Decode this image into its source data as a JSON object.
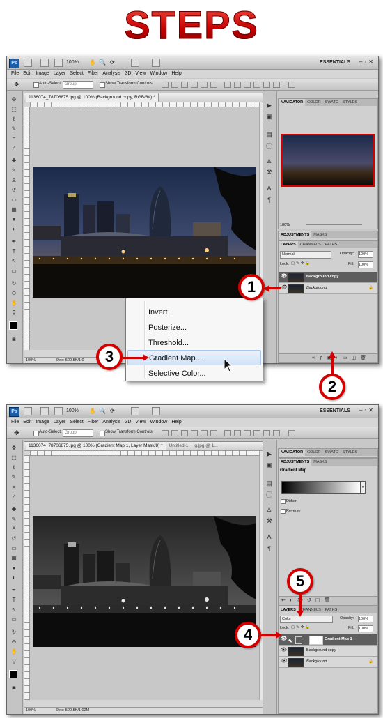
{
  "title": "STEPS",
  "app": {
    "logo": "Ps",
    "zoom": "100%",
    "workspace": "ESSENTIALS",
    "menu": [
      "File",
      "Edit",
      "Image",
      "Layer",
      "Select",
      "Filter",
      "Analysis",
      "3D",
      "View",
      "Window",
      "Help"
    ],
    "options": {
      "auto_select_label": "Auto-Select:",
      "auto_select_value": "Group",
      "transform_label": "Show Transform Controls"
    }
  },
  "window1": {
    "doc_tab": "1136074_78706875.jpg @ 100% (Background copy, RGB/8#) *",
    "status_zoom": "100%",
    "status_doc": "Doc: 520.5K/1.0",
    "navigator_tabs": [
      "NAVIGATOR",
      "COLOR",
      "SWATC",
      "STYLES"
    ],
    "navigator_zoom": "100%",
    "adj_tabs": [
      "ADJUSTMENTS",
      "MASKS"
    ],
    "layers_tabs": [
      "LAYERS",
      "CHANNELS",
      "PATHS"
    ],
    "blend_mode": "Normal",
    "opacity_label": "Opacity:",
    "opacity_value": "100%",
    "lock_label": "Lock:",
    "fill_label": "Fill:",
    "fill_value": "100%",
    "layers": [
      "Background copy",
      "Background"
    ]
  },
  "context_menu": {
    "items": [
      "Invert",
      "Posterize...",
      "Threshold...",
      "Gradient Map...",
      "Selective Color..."
    ],
    "highlighted_index": 3
  },
  "window2": {
    "doc_tabs": [
      "1136074_78706875.jpg @ 100% (Gradient Map 1, Layer Mask/8) *",
      "Untitled-1",
      "g.jpg @ 1..."
    ],
    "status_zoom": "100%",
    "status_doc": "Doc: 520.5K/1.02M",
    "navigator_tabs": [
      "NAVIGATOR",
      "COLOR",
      "SWATC",
      "STYLES"
    ],
    "adj_tabs": [
      "ADJUSTMENTS",
      "MASKS"
    ],
    "adj_title": "Gradient Map",
    "dither_label": "Dither",
    "reverse_label": "Reverse",
    "layers_tabs": [
      "LAYERS",
      "CHANNELS",
      "PATHS"
    ],
    "blend_mode": "Color",
    "opacity_label": "Opacity:",
    "opacity_value": "100%",
    "lock_label": "Lock:",
    "fill_label": "Fill:",
    "fill_value": "100%",
    "layers": [
      "Gradient Map 1",
      "Background copy",
      "Background"
    ]
  },
  "callouts": [
    "1",
    "2",
    "3",
    "4",
    "5"
  ],
  "colors": {
    "accent": "#d40000",
    "menu_highlight": "#d2e3f7",
    "selected_layer": "#5e5e5e"
  }
}
